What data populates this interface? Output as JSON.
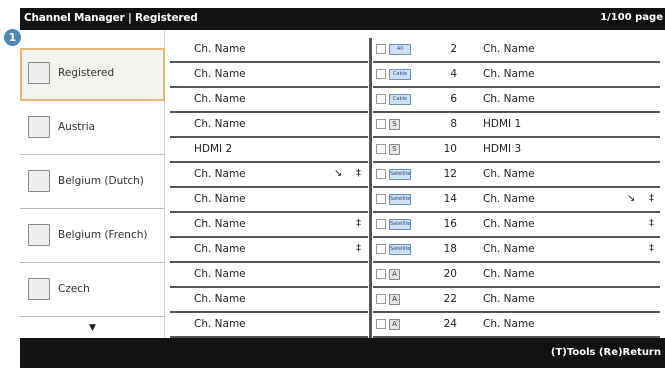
{
  "header": {
    "title": "Channel Manager | Registered",
    "page": "1/100 page"
  },
  "badge": "1",
  "sidebar": {
    "items": [
      {
        "label": "Registered"
      },
      {
        "label": "Austria"
      },
      {
        "label": "Belgium (Dutch)"
      },
      {
        "label": "Belgium (French)"
      },
      {
        "label": "Czech"
      }
    ],
    "selected": "Registered",
    "more_icon": "triangle-down-icon"
  },
  "left_rows": [
    {
      "name": "Ch. Name",
      "icons": []
    },
    {
      "name": "Ch. Name",
      "icons": []
    },
    {
      "name": "Ch. Name",
      "icons": []
    },
    {
      "name": "Ch. Name",
      "icons": []
    },
    {
      "name": "HDMI 2",
      "icons": []
    },
    {
      "name": "Ch. Name",
      "icons": [
        "antenna-icon",
        "lock-icon"
      ]
    },
    {
      "name": "Ch. Name",
      "icons": []
    },
    {
      "name": "Ch. Name",
      "icons": [
        "lock-icon"
      ]
    },
    {
      "name": "Ch. Name",
      "icons": [
        "lock-icon"
      ]
    },
    {
      "name": "Ch. Name",
      "icons": []
    },
    {
      "name": "Ch. Name",
      "icons": []
    },
    {
      "name": "Ch. Name",
      "icons": []
    }
  ],
  "right_rows": [
    {
      "type": "All",
      "num": "2",
      "name": "Ch. Name",
      "icons": []
    },
    {
      "type": "Cable",
      "num": "4",
      "name": "Ch. Name",
      "icons": []
    },
    {
      "type": "Cable",
      "num": "6",
      "name": "Ch. Name",
      "icons": []
    },
    {
      "type": "S",
      "num": "8",
      "name": "HDMI 1",
      "icons": []
    },
    {
      "type": "S",
      "num": "10",
      "name": "HDMI 3",
      "icons": []
    },
    {
      "type": "Satellite",
      "num": "12",
      "name": "Ch. Name",
      "icons": []
    },
    {
      "type": "Satellite",
      "num": "14",
      "name": "Ch. Name",
      "icons": [
        "antenna-icon",
        "lock-icon"
      ]
    },
    {
      "type": "Satellite",
      "num": "16",
      "name": "Ch. Name",
      "icons": [
        "lock-icon"
      ]
    },
    {
      "type": "Satellite",
      "num": "18",
      "name": "Ch. Name",
      "icons": [
        "lock-icon"
      ]
    },
    {
      "type": "A",
      "num": "20",
      "name": "Ch. Name",
      "icons": []
    },
    {
      "type": "A",
      "num": "22",
      "name": "Ch. Name",
      "icons": []
    },
    {
      "type": "A",
      "num": "24",
      "name": "Ch. Name",
      "icons": []
    }
  ],
  "footer": {
    "hint": "(T)Tools (Re)Return"
  },
  "colors": {
    "bar": "#121212",
    "selected_border": "#e8b87a",
    "badge": "#4c88b8",
    "tag_blue": "#cfe0f5"
  }
}
